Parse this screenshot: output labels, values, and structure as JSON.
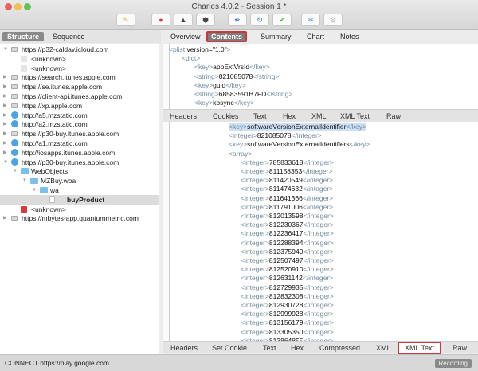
{
  "window": {
    "title": "Charles 4.0.2 - Session 1 *",
    "lights": [
      "#ec5f56",
      "#f4bd4f",
      "#5fc454"
    ]
  },
  "toolbar": [
    {
      "name": "broom-icon",
      "glyph": "✎",
      "color": "#e0b030"
    },
    {
      "name": "record-icon",
      "glyph": "●",
      "color": "#d8384a"
    },
    {
      "name": "throttle-turtle-icon",
      "glyph": "▲",
      "color": "#444"
    },
    {
      "name": "breakpoint-hexagon-icon",
      "glyph": "⬢",
      "color": "#444"
    },
    {
      "name": "compose-pen-icon",
      "glyph": "✒",
      "color": "#2d7fd0"
    },
    {
      "name": "repeat-icon",
      "glyph": "↻",
      "color": "#2d7fd0"
    },
    {
      "name": "validate-check-icon",
      "glyph": "✔",
      "color": "#46b346"
    },
    {
      "name": "tools-icon",
      "glyph": "✂",
      "color": "#2d7fd0"
    },
    {
      "name": "settings-gear-icon",
      "glyph": "⚙",
      "color": "#999"
    }
  ],
  "left_tabs": [
    "Structure",
    "Sequence"
  ],
  "tree": [
    {
      "label": "https://p32-caldav.icloud.com",
      "level": 0,
      "expanded": true,
      "icon": "lock"
    },
    {
      "label": "<unknown>",
      "level": 1,
      "icon": "unk"
    },
    {
      "label": "<unknown>",
      "level": 1,
      "icon": "unk"
    },
    {
      "label": "https://search.itunes.apple.com",
      "level": 0,
      "expanded": false,
      "icon": "lock"
    },
    {
      "label": "https://se.itunes.apple.com",
      "level": 0,
      "expanded": false,
      "icon": "lock"
    },
    {
      "label": "https://client-api.itunes.apple.com",
      "level": 0,
      "expanded": false,
      "icon": "lock"
    },
    {
      "label": "https://xp.apple.com",
      "level": 0,
      "expanded": false,
      "icon": "lock"
    },
    {
      "label": "http://a5.mzstatic.com",
      "level": 0,
      "expanded": false,
      "icon": "globe"
    },
    {
      "label": "http://a2.mzstatic.com",
      "level": 0,
      "expanded": false,
      "icon": "globe"
    },
    {
      "label": "https://p30-buy.itunes.apple.com",
      "level": 0,
      "expanded": false,
      "icon": "lock"
    },
    {
      "label": "http://a1.mzstatic.com",
      "level": 0,
      "expanded": false,
      "icon": "globe"
    },
    {
      "label": "http://iosapps.itunes.apple.com",
      "level": 0,
      "expanded": false,
      "icon": "globe"
    },
    {
      "label": "https://p30-buy.itunes.apple.com",
      "level": 0,
      "expanded": true,
      "icon": "globe"
    },
    {
      "label": "WebObjects",
      "level": 1,
      "expanded": true,
      "icon": "folder"
    },
    {
      "label": "MZBuy.woa",
      "level": 2,
      "expanded": true,
      "icon": "folder"
    },
    {
      "label": "wa",
      "level": 3,
      "expanded": true,
      "icon": "folder"
    },
    {
      "label": "buyProduct",
      "level": 4,
      "icon": "file",
      "selected": true
    },
    {
      "label": "<unknown>",
      "level": 1,
      "icon": "err"
    },
    {
      "label": "https://mbytes-app.quantummetric.com",
      "level": 0,
      "expanded": false,
      "icon": "lock"
    }
  ],
  "right_tabs": [
    "Overview",
    "Contents",
    "Summary",
    "Chart",
    "Notes"
  ],
  "right_tab_active": "Contents",
  "request": {
    "lines": [
      {
        "indent": 0,
        "open": "<plist ",
        "value": "version=\"1.0\"",
        "close": ">"
      },
      {
        "indent": 1,
        "open": "<dict>",
        "value": "",
        "close": ""
      },
      {
        "indent": 2,
        "open": "<key>",
        "value": "appExtVrsId",
        "close": "</key>"
      },
      {
        "indent": 2,
        "open": "<string>",
        "value": "821085078",
        "close": "</string>"
      },
      {
        "indent": 2,
        "open": "<key>",
        "value": "guid",
        "close": "</key>"
      },
      {
        "indent": 2,
        "open": "<string>",
        "value": "68583591B7FD",
        "close": "</string>"
      },
      {
        "indent": 2,
        "open": "<key>",
        "value": "kbsync",
        "close": "</key>"
      },
      {
        "indent": 2,
        "open": "<data>",
        "value": "AAQAA0ETNmGunnV1wXvnnlCNS355fZH0/unMMCyiZtZAWiobjfQXWiG5Dz12f",
        "close": ""
      }
    ]
  },
  "request_tabs": [
    "Headers",
    "Cookies",
    "Text",
    "Hex",
    "XML",
    "XML Text",
    "Raw"
  ],
  "request_tab_active": "XML Text",
  "response": {
    "lines": [
      {
        "indent": 0,
        "open": "<key>",
        "value": "softwareVersionExternalIdentifier",
        "close": "</key>",
        "highlight": true
      },
      {
        "indent": 0,
        "open": "<integer>",
        "value": "821085078",
        "close": "</integer>"
      },
      {
        "indent": 0,
        "open": "<key>",
        "value": "softwareVersionExternalIdentifiers",
        "close": "</key>"
      },
      {
        "indent": 0,
        "open": "<array>",
        "value": "",
        "close": ""
      },
      {
        "indent": 1,
        "open": "<integer>",
        "value": "785833618",
        "close": "</integer>"
      },
      {
        "indent": 1,
        "open": "<integer>",
        "value": "811158353",
        "close": "</integer>"
      },
      {
        "indent": 1,
        "open": "<integer>",
        "value": "811420549",
        "close": "</integer>"
      },
      {
        "indent": 1,
        "open": "<integer>",
        "value": "811474632",
        "close": "</integer>"
      },
      {
        "indent": 1,
        "open": "<integer>",
        "value": "811641366",
        "close": "</integer>"
      },
      {
        "indent": 1,
        "open": "<integer>",
        "value": "811791006",
        "close": "</integer>"
      },
      {
        "indent": 1,
        "open": "<integer>",
        "value": "812013598",
        "close": "</integer>"
      },
      {
        "indent": 1,
        "open": "<integer>",
        "value": "812230367",
        "close": "</integer>"
      },
      {
        "indent": 1,
        "open": "<integer>",
        "value": "812236417",
        "close": "</integer>"
      },
      {
        "indent": 1,
        "open": "<integer>",
        "value": "812288394",
        "close": "</integer>"
      },
      {
        "indent": 1,
        "open": "<integer>",
        "value": "812375940",
        "close": "</integer>"
      },
      {
        "indent": 1,
        "open": "<integer>",
        "value": "812507497",
        "close": "</integer>"
      },
      {
        "indent": 1,
        "open": "<integer>",
        "value": "812520910",
        "close": "</integer>"
      },
      {
        "indent": 1,
        "open": "<integer>",
        "value": "812631142",
        "close": "</integer>"
      },
      {
        "indent": 1,
        "open": "<integer>",
        "value": "812729935",
        "close": "</integer>"
      },
      {
        "indent": 1,
        "open": "<integer>",
        "value": "812832308",
        "close": "</integer>"
      },
      {
        "indent": 1,
        "open": "<integer>",
        "value": "812930728",
        "close": "</integer>"
      },
      {
        "indent": 1,
        "open": "<integer>",
        "value": "812999928",
        "close": "</integer>"
      },
      {
        "indent": 1,
        "open": "<integer>",
        "value": "813156179",
        "close": "</integer>"
      },
      {
        "indent": 1,
        "open": "<integer>",
        "value": "813305350",
        "close": "</integer>"
      },
      {
        "indent": 1,
        "open": "<integer>",
        "value": "813864855",
        "close": "</integer>"
      },
      {
        "indent": 1,
        "open": "<integer>",
        "value": "813870370",
        "close": "</integer>"
      }
    ]
  },
  "response_tabs": [
    "Headers",
    "Set Cookie",
    "Text",
    "Hex",
    "Compressed",
    "XML",
    "XML Text",
    "Raw"
  ],
  "response_tab_active": "XML Text",
  "status": {
    "text": "CONNECT https://play.google.com",
    "recording": "Recording"
  }
}
